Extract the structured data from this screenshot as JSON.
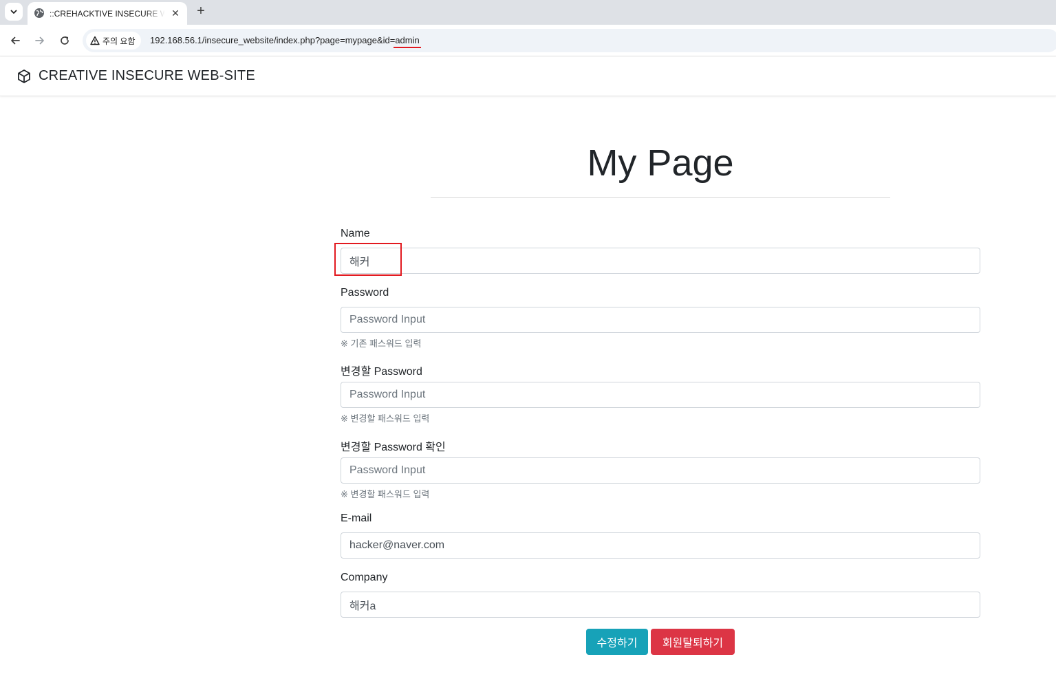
{
  "browser": {
    "tab_title": "::CREHACKTIVE INSECURE WEB-SITE::",
    "security_label": "주의 요함",
    "url_prefix": "192.168.56.1/insecure_website/index.php?page=mypage&id=",
    "url_highlight": "admin",
    "icons": [
      "chevron-down-icon",
      "globe-icon",
      "close-icon",
      "plus-icon",
      "back-icon",
      "forward-icon",
      "reload-icon",
      "warning-icon"
    ]
  },
  "site": {
    "brand": "CREATIVE INSECURE WEB-SITE",
    "brand_icon": "cube-icon"
  },
  "page": {
    "title": "My Page"
  },
  "form": {
    "name": {
      "label": "Name",
      "value": "해커"
    },
    "password": {
      "label": "Password",
      "placeholder": "Password Input",
      "help": "※ 기존 패스워드 입력"
    },
    "new_password": {
      "label": "변경할 Password",
      "placeholder": "Password Input",
      "help": "※ 변경할 패스워드 입력"
    },
    "new_password_confirm": {
      "label": "변경할 Password 확인",
      "placeholder": "Password Input",
      "help": "※ 변경할 패스워드 입력"
    },
    "email": {
      "label": "E-mail",
      "value": "hacker@naver.com"
    },
    "company": {
      "label": "Company",
      "value": "해커a"
    },
    "buttons": {
      "edit": "수정하기",
      "withdraw": "회원탈퇴하기"
    }
  },
  "colors": {
    "annotation": "#e2191f",
    "edit_button": "#17a2b8",
    "withdraw_button": "#dc3545"
  }
}
